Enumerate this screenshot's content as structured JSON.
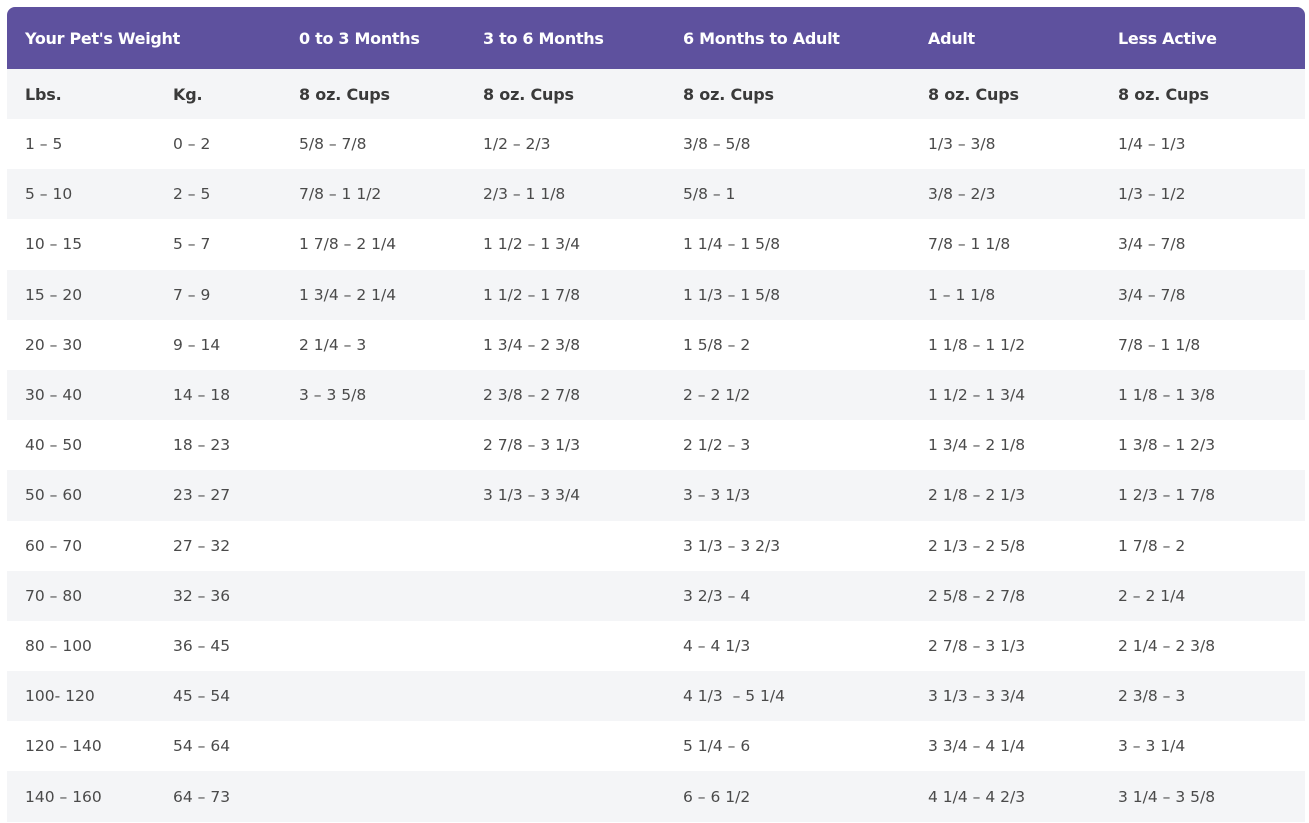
{
  "header": {
    "title": "Your Pet's Weight",
    "cols": [
      "0 to 3 Months",
      "3 to 6 Months",
      "6 Months to Adult",
      "Adult",
      "Less Active"
    ]
  },
  "subheader": {
    "lbs": "Lbs.",
    "kg": "Kg.",
    "cups": [
      "8 oz. Cups",
      "8 oz. Cups",
      "8 oz. Cups",
      "8 oz. Cups",
      "8 oz. Cups"
    ]
  },
  "rows": [
    [
      "1 – 5",
      "0 – 2",
      "5/8 – 7/8",
      "1/2 – 2/3",
      "3/8 – 5/8",
      "1/3 – 3/8",
      "1/4 – 1/3"
    ],
    [
      "5 – 10",
      "2 – 5",
      "7/8 – 1 1/2",
      "2/3 – 1 1/8",
      "5/8 – 1",
      "3/8 – 2/3",
      "1/3 – 1/2"
    ],
    [
      "10 – 15",
      "5 – 7",
      "1 7/8 – 2 1/4",
      "1 1/2 – 1 3/4",
      "1 1/4 – 1 5/8",
      "7/8 – 1 1/8",
      "3/4 – 7/8"
    ],
    [
      "15 – 20",
      "7 – 9",
      "1 3/4 – 2 1/4",
      "1 1/2 – 1 7/8",
      "1 1/3 – 1 5/8",
      "1 – 1 1/8",
      "3/4 – 7/8"
    ],
    [
      "20 – 30",
      "9 – 14",
      "2 1/4 – 3",
      "1 3/4 – 2 3/8",
      "1 5/8 – 2",
      "1 1/8 – 1 1/2",
      "7/8 – 1 1/8"
    ],
    [
      "30 – 40",
      "14 – 18",
      "3 – 3 5/8",
      "2 3/8 – 2 7/8",
      "2 – 2 1/2",
      "1 1/2 – 1 3/4",
      "1 1/8 – 1 3/8"
    ],
    [
      "40 – 50",
      "18 – 23",
      "",
      "2 7/8 – 3 1/3",
      "2 1/2 – 3",
      "1 3/4 – 2 1/8",
      "1 3/8 – 1 2/3"
    ],
    [
      "50 – 60",
      "23 – 27",
      "",
      "3 1/3 – 3 3/4",
      "3 – 3 1/3",
      "2 1/8 – 2 1/3",
      "1 2/3 – 1 7/8"
    ],
    [
      "60 – 70",
      "27 – 32",
      "",
      "",
      "3 1/3 – 3 2/3",
      "2 1/3 – 2 5/8",
      "1 7/8 – 2"
    ],
    [
      "70 – 80",
      "32 – 36",
      "",
      "",
      "3 2/3 – 4",
      "2 5/8 – 2 7/8",
      "2 – 2 1/4"
    ],
    [
      "80 – 100",
      "36 – 45",
      "",
      "",
      "4 – 4 1/3",
      "2 7/8 – 3 1/3",
      "2 1/4 – 2 3/8"
    ],
    [
      "100- 120",
      "45 – 54",
      "",
      "",
      "4 1/3  – 5 1/4",
      "3 1/3 – 3 3/4",
      "2 3/8 – 3"
    ],
    [
      "120 – 140",
      "54 – 64",
      "",
      "",
      "5 1/4 – 6",
      "3 3/4 – 4 1/4",
      "3 – 3 1/4"
    ],
    [
      "140 – 160",
      "64 – 73",
      "",
      "",
      "6 – 6 1/2",
      "4 1/4 – 4 2/3",
      "3 1/4 – 3 5/8"
    ]
  ]
}
